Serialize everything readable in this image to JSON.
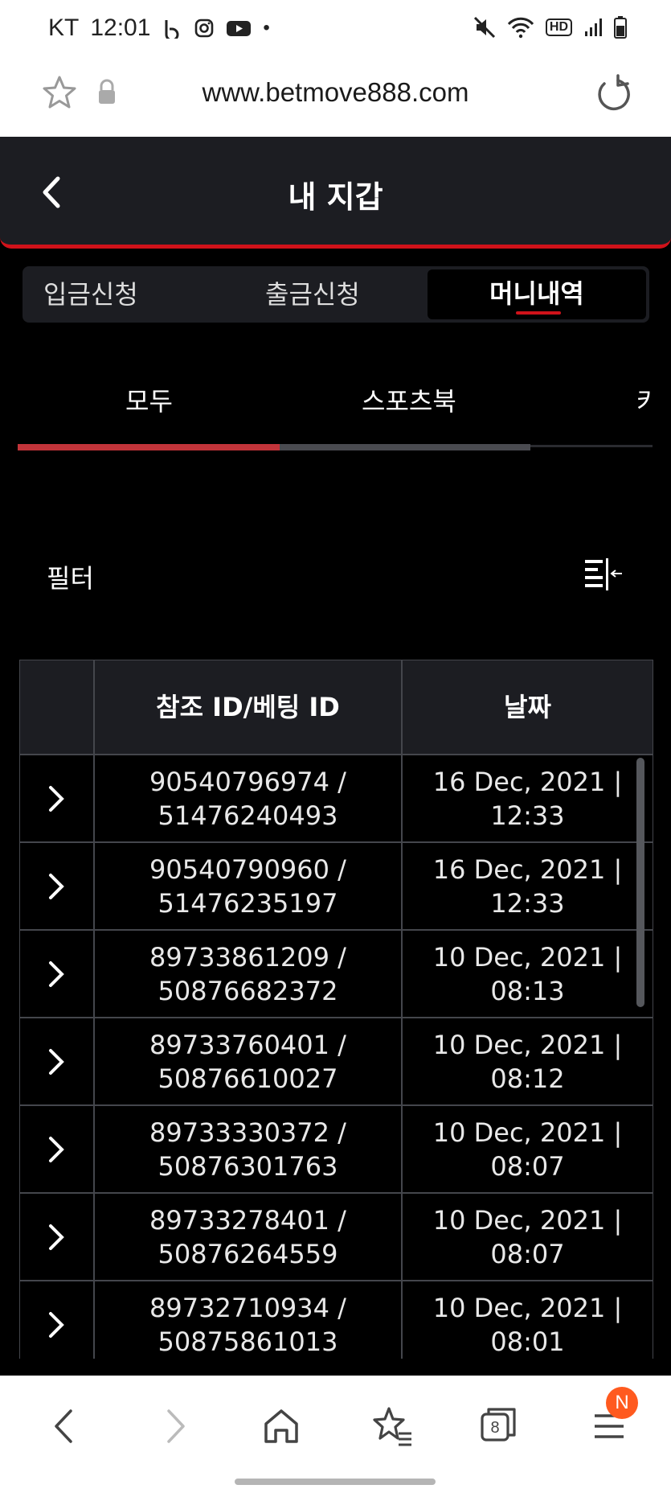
{
  "status_bar": {
    "carrier": "KT",
    "time": "12:01",
    "dot": "•",
    "hd_label": "HD"
  },
  "browser": {
    "url": "www.betmove888.com",
    "tab_count": "8",
    "menu_badge": "N"
  },
  "header": {
    "title": "내 지갑"
  },
  "wallet_tabs": [
    "입금신청",
    "출금신청",
    "머니내역"
  ],
  "sub_tabs": [
    "모두",
    "스포츠북",
    "카"
  ],
  "filter": {
    "label": "필터"
  },
  "table": {
    "headers": [
      "",
      "참조 ID/베팅 ID",
      "날짜"
    ],
    "rows": [
      {
        "ref_id": "90540796974 /",
        "bet_id": "51476240493",
        "date": "16 Dec, 2021 |",
        "time": "12:33"
      },
      {
        "ref_id": "90540790960 /",
        "bet_id": "51476235197",
        "date": "16 Dec, 2021 |",
        "time": "12:33"
      },
      {
        "ref_id": "89733861209 /",
        "bet_id": "50876682372",
        "date": "10 Dec, 2021 |",
        "time": "08:13"
      },
      {
        "ref_id": "89733760401 /",
        "bet_id": "50876610027",
        "date": "10 Dec, 2021 |",
        "time": "08:12"
      },
      {
        "ref_id": "89733330372 /",
        "bet_id": "50876301763",
        "date": "10 Dec, 2021 |",
        "time": "08:07"
      },
      {
        "ref_id": "89733278401 /",
        "bet_id": "50876264559",
        "date": "10 Dec, 2021 |",
        "time": "08:07"
      },
      {
        "ref_id": "89732710934 /",
        "bet_id": "50875861013",
        "date": "10 Dec, 2021 |",
        "time": "08:01"
      }
    ]
  },
  "colors": {
    "accent": "#d0121a",
    "header_bg": "#1c1d22",
    "badge": "#ff5a1f"
  }
}
